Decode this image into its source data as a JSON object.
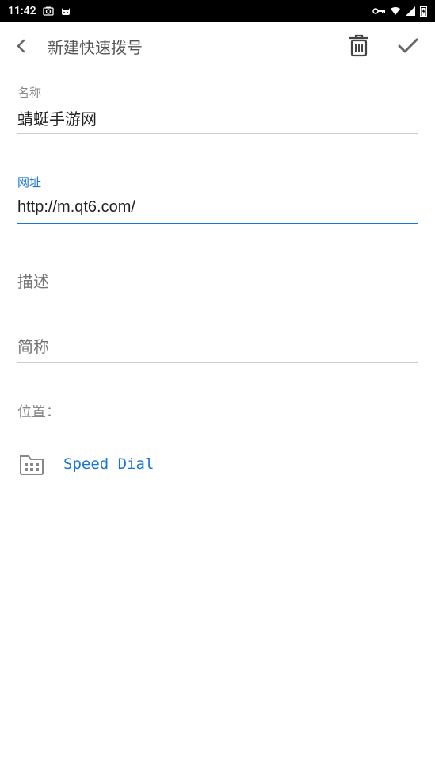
{
  "status_bar": {
    "time": "11:42",
    "icons": {
      "camera": "camera-icon",
      "cat": "cat-icon",
      "key": "key-icon",
      "wifi": "wifi-icon",
      "signal": "signal-icon",
      "battery": "battery-icon"
    }
  },
  "app_bar": {
    "title": "新建快速拨号"
  },
  "fields": {
    "name": {
      "label": "名称",
      "value": "蜻蜓手游网"
    },
    "url": {
      "label": "网址",
      "value": "http://m.qt6.com/"
    },
    "description": {
      "label": "描述",
      "value": ""
    },
    "shortname": {
      "label": "简称",
      "value": ""
    }
  },
  "location": {
    "label": "位置：",
    "folder_name": "Speed Dial"
  }
}
